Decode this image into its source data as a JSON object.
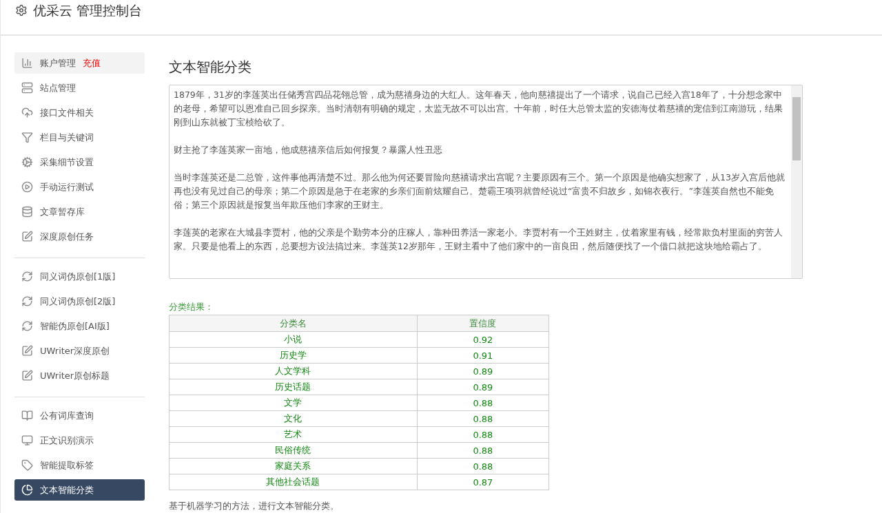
{
  "header": {
    "title": "优采云 管理控制台"
  },
  "sidebar": {
    "groups": [
      {
        "items": [
          {
            "label": "账户管理",
            "badge": "充值",
            "selected": false,
            "highlighted": true
          },
          {
            "label": "站点管理",
            "selected": false,
            "highlighted": false
          },
          {
            "label": "接口文件相关",
            "selected": false,
            "highlighted": false
          },
          {
            "label": "栏目与关键词",
            "selected": false,
            "highlighted": false
          },
          {
            "label": "采集细节设置",
            "selected": false,
            "highlighted": false
          },
          {
            "label": "手动运行测试",
            "selected": false,
            "highlighted": false
          },
          {
            "label": "文章暂存库",
            "selected": false,
            "highlighted": false
          },
          {
            "label": "深度原创任务",
            "selected": false,
            "highlighted": false
          }
        ]
      },
      {
        "items": [
          {
            "label": "同义词伪原创[1版]",
            "selected": false,
            "highlighted": false
          },
          {
            "label": "同义词伪原创[2版]",
            "selected": false,
            "highlighted": false
          },
          {
            "label": "智能伪原创[AI版]",
            "selected": false,
            "highlighted": false
          },
          {
            "label": "UWriter深度原创",
            "selected": false,
            "highlighted": false
          },
          {
            "label": "UWriter原创标题",
            "selected": false,
            "highlighted": false
          }
        ]
      },
      {
        "items": [
          {
            "label": "公有词库查询",
            "selected": false,
            "highlighted": false
          },
          {
            "label": "正文识别演示",
            "selected": false,
            "highlighted": false
          },
          {
            "label": "智能提取标签",
            "selected": false,
            "highlighted": false
          },
          {
            "label": "文本智能分类",
            "selected": true,
            "highlighted": false
          }
        ]
      }
    ]
  },
  "main": {
    "title": "文本智能分类",
    "input": {
      "paragraphs": [
        "1879年，31岁的李莲英出任储秀宫四品花翎总管，成为慈禧身边的大红人。这年春天，他向慈禧提出了一个请求，说自己已经入宫18年了，十分想念家中的老母，希望可以恩准自己回乡探亲。当时清朝有明确的规定，太监无故不可以出宫。十年前，时任大总管太监的安德海仗着慈禧的宠信到江南游玩，结果刚到山东就被丁宝桢给砍了。",
        "财主抢了李莲英家一亩地，他成慈禧亲信后如何报复？暴露人性丑恶",
        "当时李莲英还是二总管，这件事他再清楚不过。那么他为何还要冒险向慈禧请求出宫呢？主要原因有三个。第一个原因是他确实想家了，从13岁入宫后他就再也没有见过自己的母亲；第二个原因是急于在老家的乡亲们面前炫耀自己。楚霸王项羽就曾经说过“富贵不归故乡，如锦衣夜行。”李莲英自然也不能免俗；第三个原因就是报复当年欺压他们李家的王财主。",
        "李莲英的老家在大城县李贾村，他的父亲是个勤劳本分的庄稼人，靠种田养活一家老小。李贾村有一个王姓财主，仗着家里有钱，经常欺负村里面的穷苦人家。只要是他看上的东西，总要想方设法搞过来。李莲英12岁那年，王财主看中了他们家中的一亩良田，然后随便找了一个借口就把这块地给霸占了。"
      ]
    },
    "result_label": "分类结果：",
    "table": {
      "columns": [
        "分类名",
        "置信度"
      ],
      "rows": [
        [
          "小说",
          "0.92"
        ],
        [
          "历史学",
          "0.91"
        ],
        [
          "人文学科",
          "0.89"
        ],
        [
          "历史话题",
          "0.89"
        ],
        [
          "文学",
          "0.88"
        ],
        [
          "文化",
          "0.88"
        ],
        [
          "艺术",
          "0.88"
        ],
        [
          "民俗传统",
          "0.88"
        ],
        [
          "家庭关系",
          "0.88"
        ],
        [
          "其他社会话题",
          "0.87"
        ]
      ]
    },
    "footnote": "基于机器学习的方法，进行文本智能分类。"
  }
}
